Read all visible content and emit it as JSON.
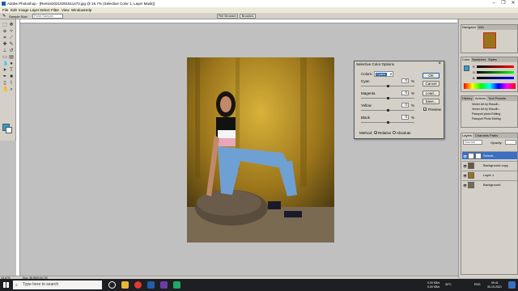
{
  "window": {
    "title": "Adobe Photoshop - [Remini20210201511472.jpg @ 16.7% (Selective Color 1, Layer Mask)]",
    "controls": [
      "–",
      "❐",
      "✕"
    ]
  },
  "menu": [
    "File",
    "Edit",
    "Image",
    "Layer",
    "Select",
    "Filter",
    "View",
    "Window",
    "Help"
  ],
  "options_bar": {
    "sample_size_label": "Sample Size:",
    "sample_size_value": "Point Sample",
    "tab_file_browser": "File Browser",
    "tab_brushes": "Brushes"
  },
  "dialog": {
    "title": "Selective Color Options",
    "colors_label": "Colors:",
    "colors_value": "Cyans",
    "sliders": [
      {
        "label": "Cyan",
        "value": "0",
        "unit": "%"
      },
      {
        "label": "Magenta",
        "value": "0",
        "unit": "%"
      },
      {
        "label": "Yellow",
        "value": "0",
        "unit": "%"
      },
      {
        "label": "Black",
        "value": "0",
        "unit": "%"
      }
    ],
    "method_label": "Method:",
    "method_relative": "Relative",
    "method_absolute": "Absolute",
    "method_selected": "Relative",
    "buttons": {
      "ok": "OK",
      "cancel": "Cancel",
      "load": "Load...",
      "save": "Save..."
    },
    "preview_label": "Preview",
    "preview_checked": true
  },
  "panels": {
    "navigator": {
      "tabs": [
        "Navigator",
        "Info"
      ]
    },
    "color": {
      "tabs": [
        "Color",
        "Swatches",
        "Styles"
      ],
      "labels": [
        "R",
        "G",
        "B"
      ]
    },
    "history": {
      "tabs": [
        "History",
        "Actions",
        "Tool Presets"
      ],
      "items": [
        "Vector Art by Eksudh...",
        "Vector Art by Eksudh...",
        "Passport photo Editing",
        "Passport Photo Editing"
      ]
    },
    "layers": {
      "tabs": [
        "Layers",
        "Channels",
        "Paths"
      ],
      "blend_mode": "Normal",
      "opacity_label": "Opacity:",
      "layers": [
        "Selecti...",
        "Background copy",
        "Layer 1",
        "Background"
      ]
    }
  },
  "status": {
    "doc": "Doc: 38.9M/104.7M",
    "zoom": "16.67%"
  },
  "taskbar": {
    "search_placeholder": "Type here to search",
    "tray_time": "09:41",
    "tray_date": "30-10-2021",
    "tray_lang": "ENG",
    "net_up": "0.00 KB/s",
    "net_down": "0.00 KB/s",
    "tray_temp": "30°C"
  },
  "colors": {
    "accent": "#1f5fa8",
    "selection": "#3a6fc4",
    "foreground_swatch": "#2a9fd6",
    "taskbar": "#1e1f22"
  }
}
